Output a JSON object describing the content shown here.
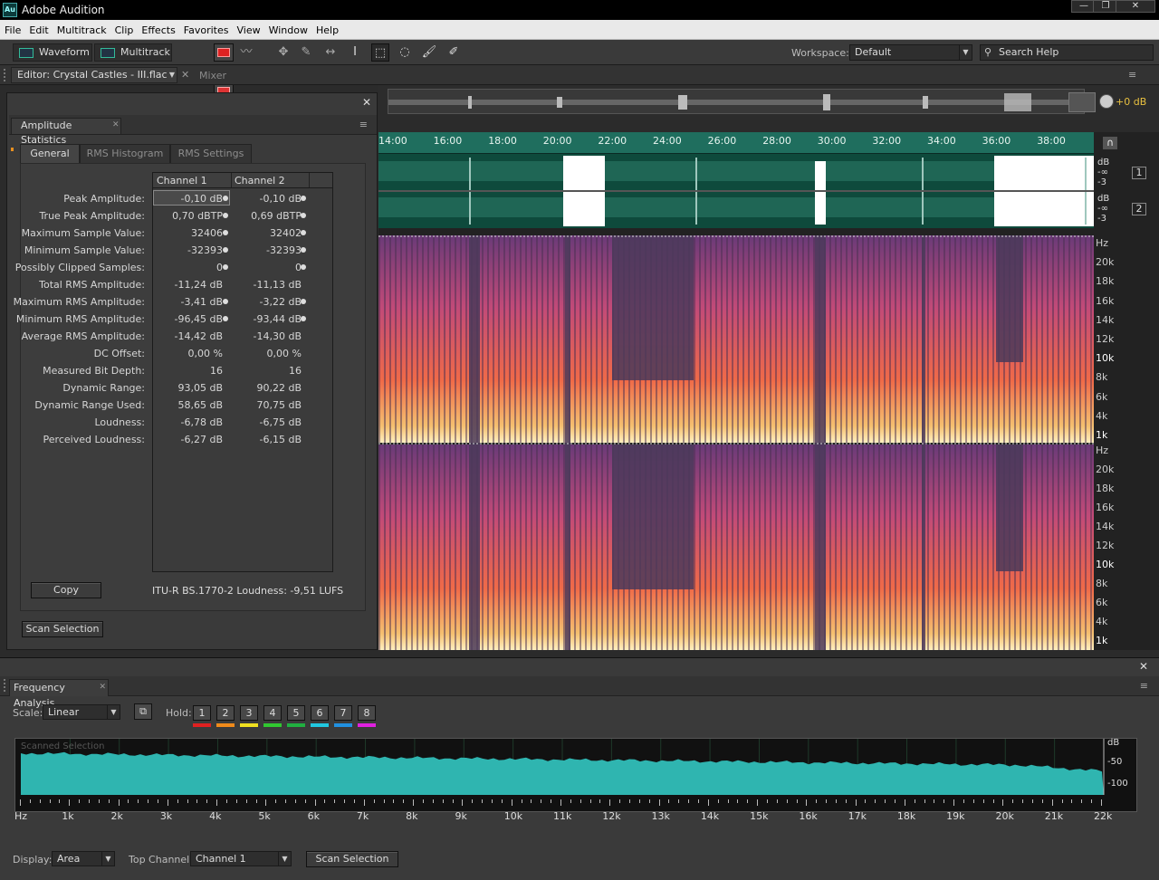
{
  "app": {
    "title": "Adobe Audition",
    "logo_text": "Au"
  },
  "window_controls": {
    "minimize": "—",
    "restore": "❐",
    "close": "✕"
  },
  "menu": [
    "File",
    "Edit",
    "Multitrack",
    "Clip",
    "Effects",
    "Favorites",
    "View",
    "Window",
    "Help"
  ],
  "toolbar": {
    "waveform_label": "Waveform",
    "multitrack_label": "Multitrack",
    "workspace_label": "Workspace:",
    "workspace_value": "Default",
    "search_placeholder": "Search Help"
  },
  "editor": {
    "tab_label": "Editor: Crystal Castles - III.flac",
    "mixer_label": "Mixer",
    "timeline_ticks": [
      "14:00",
      "16:00",
      "18:00",
      "20:00",
      "22:00",
      "24:00",
      "26:00",
      "28:00",
      "30:00",
      "32:00",
      "34:00",
      "36:00",
      "38:00"
    ],
    "gain_value": "+0 dB",
    "db_scale_ch1": [
      "dB",
      "-∞",
      "-3"
    ],
    "db_scale_ch2": [
      "dB",
      "-∞",
      "-3"
    ],
    "channel_buttons": [
      "1",
      "2"
    ],
    "spectral_scale_ch1": [
      "Hz",
      "20k",
      "18k",
      "16k",
      "14k",
      "12k",
      "10k",
      "8k",
      "6k",
      "4k",
      "1k"
    ],
    "spectral_scale_ch2": [
      "Hz",
      "20k",
      "18k",
      "16k",
      "14k",
      "12k",
      "10k",
      "8k",
      "6k",
      "4k",
      "1k"
    ]
  },
  "amplitude_stats": {
    "panel_title": "Amplitude Statistics",
    "tabs": [
      "General",
      "RMS Histogram",
      "RMS Settings"
    ],
    "col_headers": [
      "Channel 1",
      "Channel 2"
    ],
    "rows": [
      {
        "label": "Peak Amplitude:",
        "c1": "-0,10 dB",
        "c2": "-0,10 dB",
        "dots": true
      },
      {
        "label": "True Peak Amplitude:",
        "c1": "0,70 dBTP",
        "c2": "0,69 dBTP",
        "dots": true
      },
      {
        "label": "Maximum Sample Value:",
        "c1": "32406",
        "c2": "32402",
        "dots": true
      },
      {
        "label": "Minimum Sample Value:",
        "c1": "-32393",
        "c2": "-32393",
        "dots": true
      },
      {
        "label": "Possibly Clipped Samples:",
        "c1": "0",
        "c2": "0",
        "dots": true
      },
      {
        "label": "Total RMS Amplitude:",
        "c1": "-11,24 dB",
        "c2": "-11,13 dB",
        "dots": false
      },
      {
        "label": "Maximum RMS Amplitude:",
        "c1": "-3,41 dB",
        "c2": "-3,22 dB",
        "dots": true
      },
      {
        "label": "Minimum RMS Amplitude:",
        "c1": "-96,45 dB",
        "c2": "-93,44 dB",
        "dots": true
      },
      {
        "label": "Average RMS Amplitude:",
        "c1": "-14,42 dB",
        "c2": "-14,30 dB",
        "dots": false
      },
      {
        "label": "DC Offset:",
        "c1": "0,00 %",
        "c2": "0,00 %",
        "dots": false
      },
      {
        "label": "Measured Bit Depth:",
        "c1": "16",
        "c2": "16",
        "dots": false
      },
      {
        "label": "Dynamic Range:",
        "c1": "93,05 dB",
        "c2": "90,22 dB",
        "dots": false
      },
      {
        "label": "Dynamic Range Used:",
        "c1": "58,65 dB",
        "c2": "70,75 dB",
        "dots": false
      },
      {
        "label": "Loudness:",
        "c1": "-6,78 dB",
        "c2": "-6,75 dB",
        "dots": false
      },
      {
        "label": "Perceived Loudness:",
        "c1": "-6,27 dB",
        "c2": "-6,15 dB",
        "dots": false
      }
    ],
    "copy_label": "Copy",
    "itu_loudness": "ITU-R BS.1770-2 Loudness: -9,51 LUFS",
    "scan_label": "Scan Selection"
  },
  "frequency": {
    "panel_title": "Frequency Analysis",
    "scale_label": "Scale:",
    "scale_value": "Linear",
    "hold_label": "Hold:",
    "holds": [
      "1",
      "2",
      "3",
      "4",
      "5",
      "6",
      "7",
      "8"
    ],
    "hold_colors": [
      "#e02020",
      "#f08a1a",
      "#f0e020",
      "#30c830",
      "#20b040",
      "#20c8e0",
      "#2090e0",
      "#e020e0"
    ],
    "graph_title": "Scanned Selection",
    "db_labels": [
      "dB",
      "-50",
      "-100"
    ],
    "x_ticks": [
      "Hz",
      "1k",
      "2k",
      "3k",
      "4k",
      "5k",
      "6k",
      "7k",
      "8k",
      "9k",
      "10k",
      "11k",
      "12k",
      "13k",
      "14k",
      "15k",
      "16k",
      "17k",
      "18k",
      "19k",
      "20k",
      "21k",
      "22k"
    ],
    "display_label": "Display:",
    "display_value": "Area",
    "top_channel_label": "Top Channel:",
    "top_channel_value": "Channel 1",
    "scan_label": "Scan Selection",
    "curve_fill_color": "#2fb5b0"
  }
}
